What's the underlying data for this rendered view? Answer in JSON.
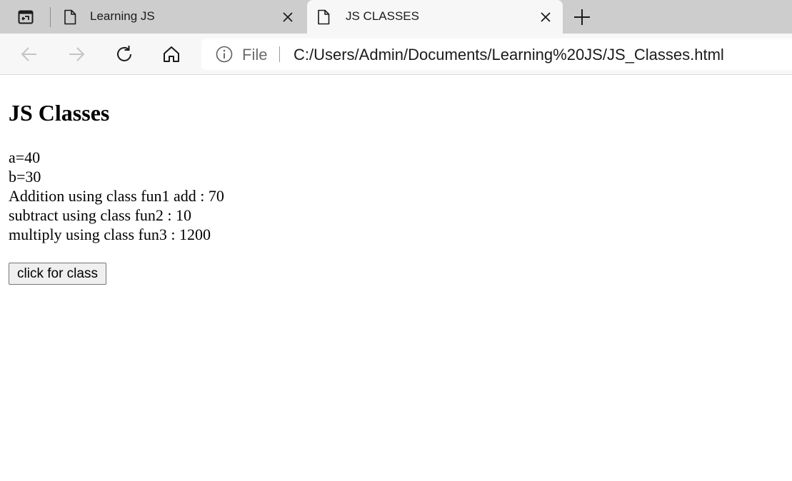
{
  "browser": {
    "tabs": [
      {
        "title": "Learning JS",
        "active": false
      },
      {
        "title": "JS CLASSES",
        "active": true
      }
    ],
    "address_bar": {
      "site_label": "File",
      "url": "C:/Users/Admin/Documents/Learning%20JS/JS_Classes.html"
    },
    "icons": {
      "tab_actions": "tab-actions-icon",
      "page": "page-icon",
      "close": "close-icon",
      "new_tab": "plus-icon",
      "back": "back-arrow-icon",
      "forward": "forward-arrow-icon",
      "refresh": "refresh-icon",
      "home": "home-icon",
      "info": "info-icon"
    }
  },
  "page": {
    "title": "JS Classes",
    "lines": [
      "a=40",
      "b=30",
      "Addition using class fun1 add : 70",
      "subtract using class fun2 : 10",
      "multiply using class fun3 : 1200"
    ],
    "button_label": "click for class"
  },
  "colors": {
    "tabstrip_bg": "#cdcdcd",
    "toolbar_bg": "#f7f7f7",
    "page_bg": "#ffffff"
  }
}
